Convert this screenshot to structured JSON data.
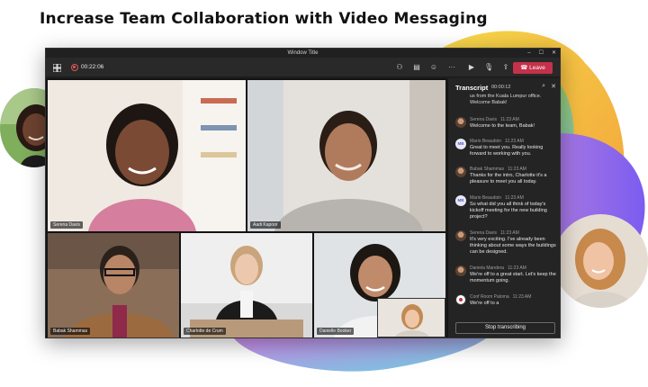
{
  "headline": "Increase Team Collaboration with Video Messaging",
  "window": {
    "title": "Window Title",
    "controls": [
      "–",
      "☐",
      "✕"
    ]
  },
  "toolbar": {
    "timer": "00:22:06",
    "leave_label": "Leave",
    "icons": [
      "people-icon",
      "chat-icon",
      "reactions-icon",
      "more-icon",
      "camera-icon",
      "mic-icon",
      "share-icon"
    ],
    "icon_glyphs": [
      "⚇",
      "▤",
      "☺",
      "···",
      "▶",
      "🎙",
      "⇪"
    ]
  },
  "participants": [
    {
      "name": "Serena Davis"
    },
    {
      "name": "Aadi Kapoor"
    },
    {
      "name": "Babak Shammas"
    },
    {
      "name": "Charlotte de Crum"
    },
    {
      "name": "Danielle Booker"
    }
  ],
  "transcript": {
    "title": "Transcript",
    "time": "00:00:12",
    "first_line": "us from the Kuala Lumpur office. Welcome Babak!",
    "entries": [
      {
        "speaker": "Serena Davis",
        "time": "11:23 AM",
        "avatar": "photo",
        "text": "Welcome to the team, Babak!"
      },
      {
        "speaker": "Mario Beaudoin",
        "time": "11:23 AM",
        "avatar": "MB",
        "text": "Great to meet you. Really looking forward to working with you."
      },
      {
        "speaker": "Babak Shammas",
        "time": "11:23 AM",
        "avatar": "photo",
        "text": "Thanks for the intro, Charlotte it's a pleasure to meet you all today."
      },
      {
        "speaker": "Mario Beaudoin",
        "time": "11:23 AM",
        "avatar": "MB",
        "text": "So what did you all think of today's kickoff meeting for the new building project?"
      },
      {
        "speaker": "Serena Davis",
        "time": "11:23 AM",
        "avatar": "photo",
        "text": "It's very exciting. I've already been thinking about some ways the buildings can be designed."
      },
      {
        "speaker": "Daniela Mandera",
        "time": "11:23 AM",
        "avatar": "photo",
        "text": "We're off to a great start. Let's keep the momentum going."
      },
      {
        "speaker": "Conf Room Paloma",
        "time": "11:23 AM",
        "avatar": "room",
        "text": "We're off to a"
      }
    ],
    "stop_label": "Stop transcribing"
  }
}
